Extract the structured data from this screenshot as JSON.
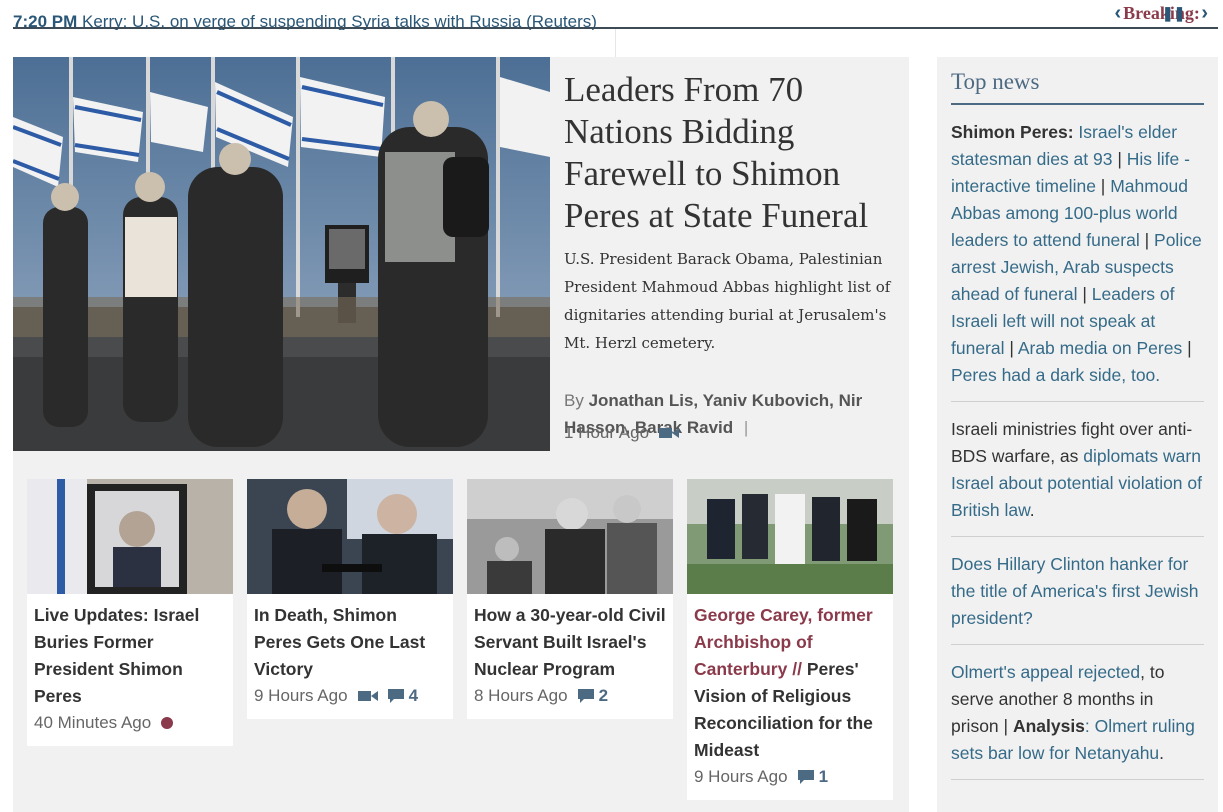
{
  "ticker": {
    "time": "7:20 PM",
    "headline": "Kerry: U.S. on verge of suspending Syria talks with Russia (Reuters)",
    "breaking_label": "Breaking:"
  },
  "lead": {
    "headline": "Leaders From 70 Nations Bidding Farewell to Shimon Peres at State Funeral",
    "summary": "U.S. President Barack Obama, Palestinian President Mahmoud Abbas highlight list of dignitaries attending burial at Jerusalem's Mt. Herzl cemetery.",
    "by": "By",
    "authors": "Jonathan Lis, Yaniv Kubovich, Nir Hasson, Barak Ravid",
    "separator": "|",
    "time": "1 Hour Ago"
  },
  "cards": [
    {
      "title": "Live Updates: Israel Buries Former President Shimon Peres",
      "time": "40 Minutes Ago"
    },
    {
      "title": "In Death, Shimon Peres Gets One Last Victory",
      "time": "9 Hours Ago",
      "comments": "4"
    },
    {
      "title": "How a 30-year-old Civil Servant Built Israel's Nuclear Program",
      "time": "8 Hours Ago",
      "comments": "2"
    },
    {
      "title_accent": "George Carey, former Archbishop of Canterbury // ",
      "title": "Peres' Vision of Religious Reconciliation for the Mideast",
      "time": "9 Hours Ago",
      "comments": "1"
    }
  ],
  "sidebar": {
    "title": "Top news",
    "item1": {
      "lead": "Shimon Peres:",
      "l1": "Israel's elder statesman dies at 93",
      "l2": "His life - interactive timeline",
      "l3": "Mahmoud Abbas among 100-plus world leaders to attend funeral",
      "l4": "Police arrest Jewish, Arab suspects ahead of funeral",
      "l5": "Leaders of Israeli left will not speak at funeral",
      "l6": "Arab media on Peres",
      "l7": "Peres had a dark side, too.",
      "sep": " | "
    },
    "item2": {
      "text": "Israeli ministries fight over anti-BDS warfare, as ",
      "link": "diplomats warn Israel about potential violation of British law",
      "end": "."
    },
    "item3": {
      "link": "Does Hillary Clinton hanker for the title of America's first Jewish president?"
    },
    "item4": {
      "link": "Olmert's appeal rejected",
      "text": ", to serve another 8 months in prison | ",
      "bold": "Analysis",
      "link2": ": Olmert ruling sets bar low for Netanyahu",
      "end": "."
    }
  },
  "colors": {
    "link": "#356b88",
    "accent": "#8a3a4a",
    "sidebar_title": "#4d6a83"
  }
}
